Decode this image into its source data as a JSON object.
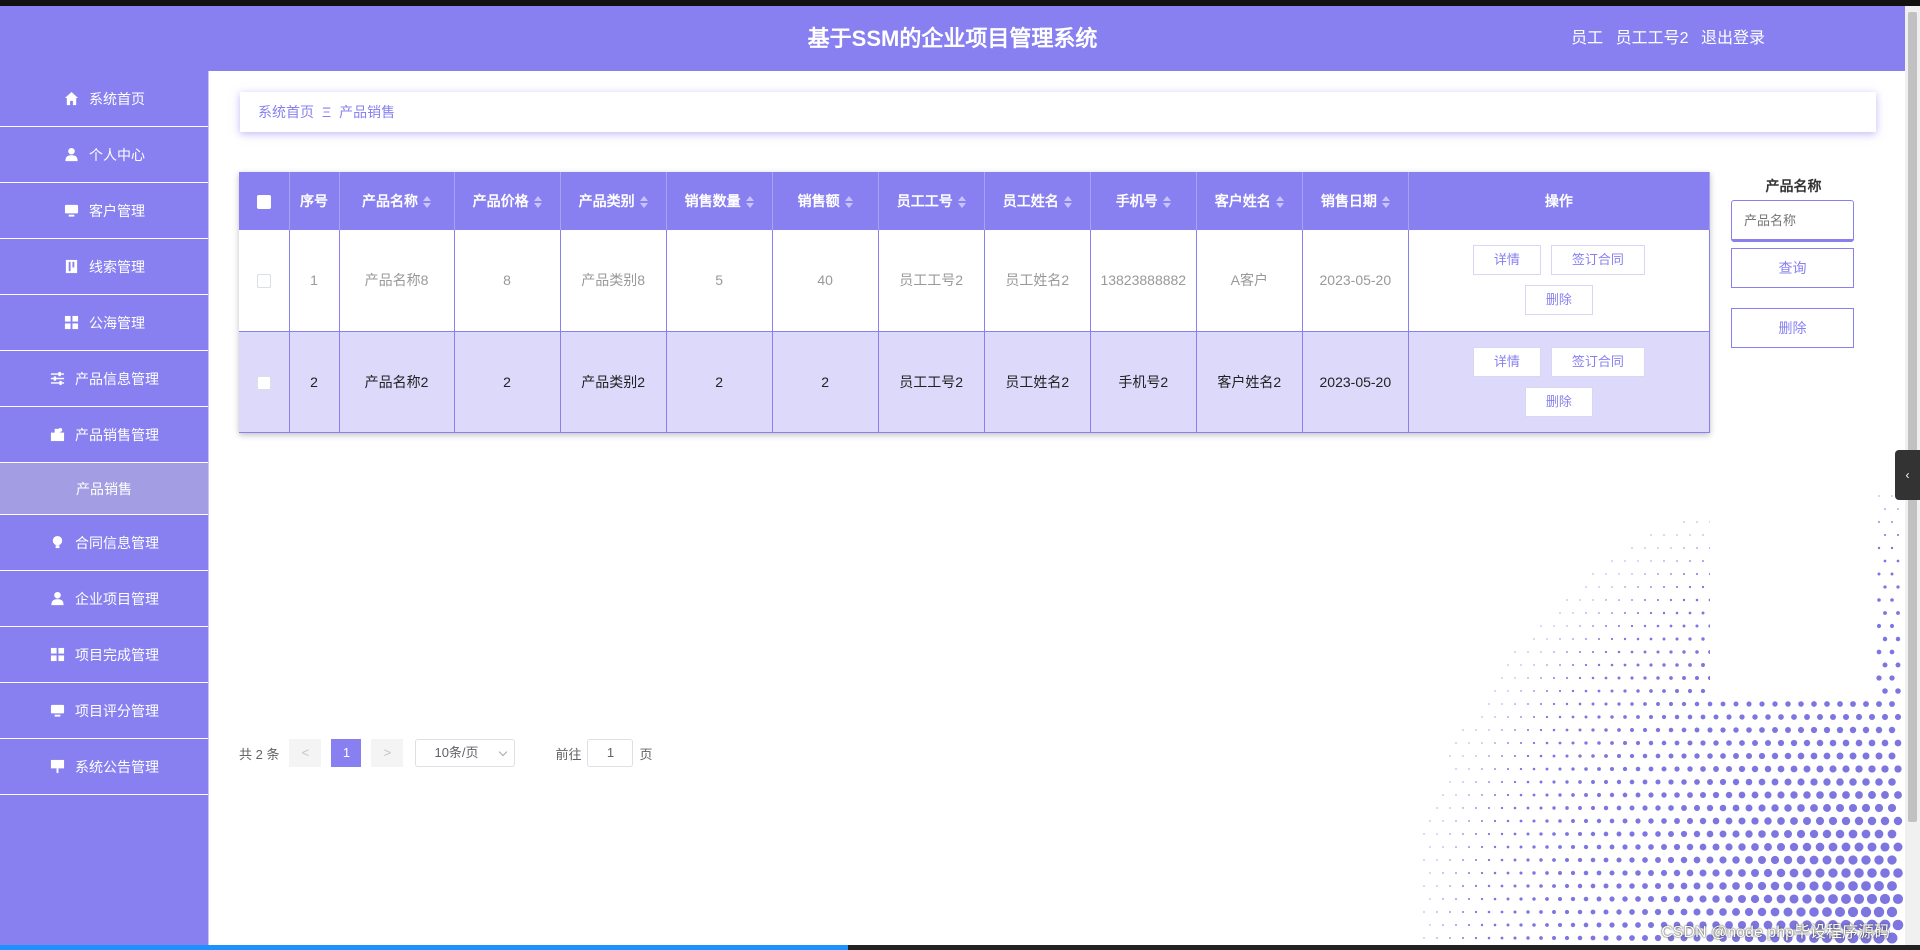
{
  "header": {
    "title": "基于SSM的企业项目管理系统",
    "role": "员工",
    "user": "员工工号2",
    "logout": "退出登录"
  },
  "sidebar": {
    "items": [
      {
        "label": "系统首页",
        "icon": "home-icon"
      },
      {
        "label": "个人中心",
        "icon": "user-icon"
      },
      {
        "label": "客户管理",
        "icon": "monitor-icon"
      },
      {
        "label": "线索管理",
        "icon": "document-icon"
      },
      {
        "label": "公海管理",
        "icon": "grid-icon"
      },
      {
        "label": "产品信息管理",
        "icon": "sliders-icon"
      },
      {
        "label": "产品销售管理",
        "icon": "sales-icon"
      },
      {
        "label": "合同信息管理",
        "icon": "bulb-icon"
      },
      {
        "label": "企业项目管理",
        "icon": "user-icon"
      },
      {
        "label": "项目完成管理",
        "icon": "grid-icon"
      },
      {
        "label": "项目评分管理",
        "icon": "monitor-icon"
      },
      {
        "label": "系统公告管理",
        "icon": "board-icon"
      }
    ],
    "subitem": "产品销售"
  },
  "breadcrumb": {
    "home": "系统首页",
    "sep": "Ξ",
    "current": "产品销售"
  },
  "table": {
    "headers": [
      "序号",
      "产品名称",
      "产品价格",
      "产品类别",
      "销售数量",
      "销售额",
      "员工工号",
      "员工姓名",
      "手机号",
      "客户姓名",
      "销售日期",
      "操作"
    ],
    "rows": [
      {
        "index": "1",
        "name": "产品名称8",
        "price": "8",
        "category": "产品类别8",
        "qty": "5",
        "amount": "40",
        "emp_no": "员工工号2",
        "emp_name": "员工姓名2",
        "phone": "13823888882",
        "customer": "A客户",
        "date": "2023-05-20"
      },
      {
        "index": "2",
        "name": "产品名称2",
        "price": "2",
        "category": "产品类别2",
        "qty": "2",
        "amount": "2",
        "emp_no": "员工工号2",
        "emp_name": "员工姓名2",
        "phone": "手机号2",
        "customer": "客户姓名2",
        "date": "2023-05-20"
      }
    ],
    "actions": {
      "detail": "详情",
      "contract": "签订合同",
      "delete": "删除"
    }
  },
  "search": {
    "label": "产品名称",
    "placeholder": "产品名称",
    "query": "查询",
    "delete": "删除"
  },
  "pagination": {
    "total": "共 2 条",
    "prev": "<",
    "page": "1",
    "next": ">",
    "page_size": "10条/页",
    "goto_prefix": "前往",
    "goto_value": "1",
    "goto_suffix": "页"
  },
  "watermark": "CSDN @node php毕设程序源码",
  "colors": {
    "accent": "#8880f0",
    "row_highlight": "#dcd9fb"
  }
}
